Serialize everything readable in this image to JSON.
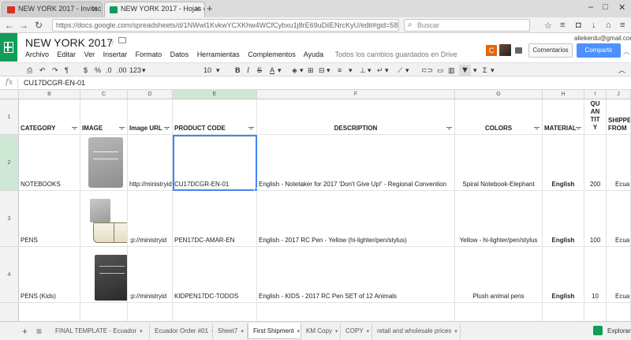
{
  "browser": {
    "tabs": [
      {
        "label": "NEW YORK 2017 - Invitaci...",
        "favicon_color": "#d93025"
      },
      {
        "label": "NEW YORK 2017 - Hojas d...",
        "favicon_color": "#0f9d58"
      }
    ],
    "url": "https://docs.google.com/spreadsheets/d/1NWwl1KvkwYCXKhw4WCfCybxu1j8rE69uDilENrcKyU/edit#gid=58f0e426#gid",
    "search_placeholder": "Buscar"
  },
  "doc": {
    "title": "NEW YORK 2017",
    "menu": [
      "Archivo",
      "Editar",
      "Ver",
      "Insertar",
      "Formato",
      "Datos",
      "Herramientas",
      "Complementos",
      "Ayuda"
    ],
    "saved_status": "Todos los cambios guardados en Drive",
    "user_email": "aliekerdu@gmail.com",
    "user_initial": "C",
    "comments_label": "Comentarios",
    "share_label": "Compartir"
  },
  "toolbar": {
    "currency": "$",
    "percent": "%",
    "dec_less": ".0",
    "dec_more": ".00",
    "format_more": "123",
    "font_size": "10"
  },
  "formula": {
    "fx": "fx",
    "value": "CU17DCGR-EN-01"
  },
  "sheet": {
    "columns": [
      "B",
      "C",
      "D",
      "E",
      "F",
      "G",
      "H",
      "I",
      "J"
    ],
    "row_numbers": [
      "1",
      "2",
      "3",
      "4"
    ],
    "headers": {
      "category": "CATEGORY",
      "image": "IMAGE",
      "image_url": "Image URL",
      "product_code": "PRODUCT CODE",
      "description": "DESCRIPTION",
      "colors": "COLORS",
      "material": "MATERIAL",
      "qty_1": "QU",
      "qty_2": "AN",
      "qty_3": "TIT",
      "qty_4": "Y",
      "shipped_1": "SHIPPE",
      "shipped_2": "FROM"
    },
    "rows": [
      {
        "category": "NOTEBOOKS",
        "image_url": "http://ministryid",
        "product_code": "CU17DCGR-EN-01",
        "description": "English - Notetaker for 2017 'Don't Give Up!' - Regional Convention",
        "colors": "Spiral Notebook-Elephant",
        "material": "English",
        "qty": "200",
        "shipped": "Ecua"
      },
      {
        "category": "PENS",
        "image_url": ":p://ministryid",
        "product_code": "PEN17DC-AMAR-EN",
        "description": "English - 2017 RC Pen - Yellow (hi-lighter/pen/stylus)",
        "colors": "Yellow - hi-lighter/pen/stylus",
        "material": "English",
        "qty": "100",
        "shipped": "Ecua"
      },
      {
        "category": "PENS (Kids)",
        "image_url": ":p://ministryid",
        "product_code": "KIDPEN17DC-TODOS",
        "description": "English - KIDS - 2017 RC Pen SET of 12 Animals",
        "colors": "Plush animal pens",
        "material": "English",
        "qty": "10",
        "shipped": "Ecua"
      }
    ]
  },
  "sheet_tabs": {
    "tabs": [
      "FINAL TEMPLATE - Ecuador",
      "Ecuador Order #01",
      "Sheet7",
      "First Shipment",
      "KM Copy",
      "COPY",
      "retail and wholesale prices"
    ],
    "active": "First Shipment",
    "explore_label": "Explorar"
  }
}
